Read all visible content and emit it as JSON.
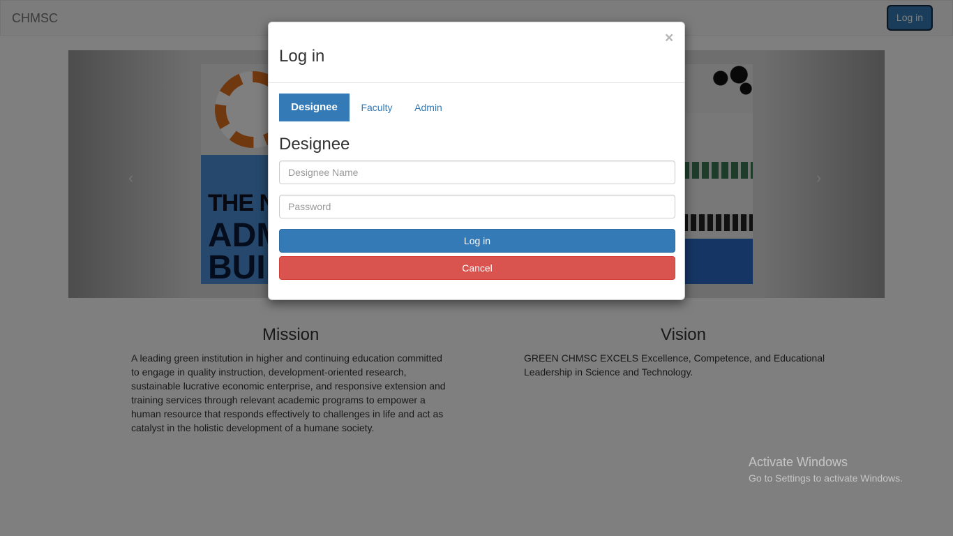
{
  "navbar": {
    "brand": "CHMSC",
    "login_label": "Log in"
  },
  "carousel": {
    "prev_icon": "‹",
    "next_icon": "›",
    "slide_text": [
      "THE N",
      "ADM",
      "BUIL"
    ]
  },
  "mission": {
    "title": "Mission",
    "text": "A leading green institution in higher and continuing education committed to engage in quality instruction, development-oriented research, sustainable lucrative economic enterprise, and responsive extension and training services through relevant academic programs to empower a human resource that responds effectively to challenges in life and act as catalyst in the holistic development of a humane society."
  },
  "vision": {
    "title": "Vision",
    "text": "GREEN CHMSC EXCELS Excellence, Competence, and Educational Leadership in Science and Technology."
  },
  "modal": {
    "title": "Log in",
    "close_icon": "×",
    "tabs": [
      {
        "label": "Designee",
        "active": true
      },
      {
        "label": "Faculty",
        "active": false
      },
      {
        "label": "Admin",
        "active": false
      }
    ],
    "section_title": "Designee",
    "name_placeholder": "Designee Name",
    "password_placeholder": "Password",
    "login_label": "Log in",
    "cancel_label": "Cancel"
  },
  "watermark": {
    "title": "Activate Windows",
    "subtitle": "Go to Settings to activate Windows."
  },
  "colors": {
    "primary": "#337ab7",
    "danger": "#d9534f"
  }
}
